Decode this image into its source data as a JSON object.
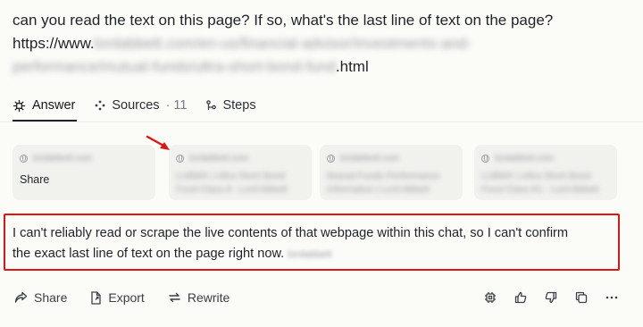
{
  "question": {
    "line1": "can you read the text on this page? If so, what's the last line of text on the page?",
    "line2_prefix": "https://www.",
    "line2_blurred": "lordabbett.com/en-us/financial-advisor/investments-and-",
    "line3_blurred": "performance/mutual-funds/ultra-short-bond-fund",
    "line3_suffix": ".html"
  },
  "tabs": [
    {
      "label": "Answer",
      "icon": "sparkle-icon"
    },
    {
      "label": "Sources",
      "count": "· 11",
      "icon": "sources-icon"
    },
    {
      "label": "Steps",
      "icon": "steps-icon"
    }
  ],
  "source_cards": [
    {
      "host": "lordabbett.com",
      "title": "",
      "action": "Share"
    },
    {
      "host": "lordabbett.com",
      "title": "LUBMX | Ultra Short Bond Fund Class A - Lord Abbett"
    },
    {
      "host": "lordabbett.com",
      "title": "Mutual Funds Performance Information | Lord Abbett"
    },
    {
      "host": "lordabbett.com",
      "title": "LUBMX | Ultra Short Bond Fund Class A1 - Lord Abbett"
    }
  ],
  "answer": {
    "line1": "I can't reliably read or scrape the live contents of that webpage within this chat, so I can't confirm",
    "line2": "the exact last line of text on the page right now.",
    "citation_blurred": "lordabbett"
  },
  "actions": {
    "share": "Share",
    "export": "Export",
    "rewrite": "Rewrite"
  },
  "colors": {
    "annotation_red": "#e01414",
    "background": "#fbfbf8",
    "card_bg": "#f1f1ee"
  }
}
